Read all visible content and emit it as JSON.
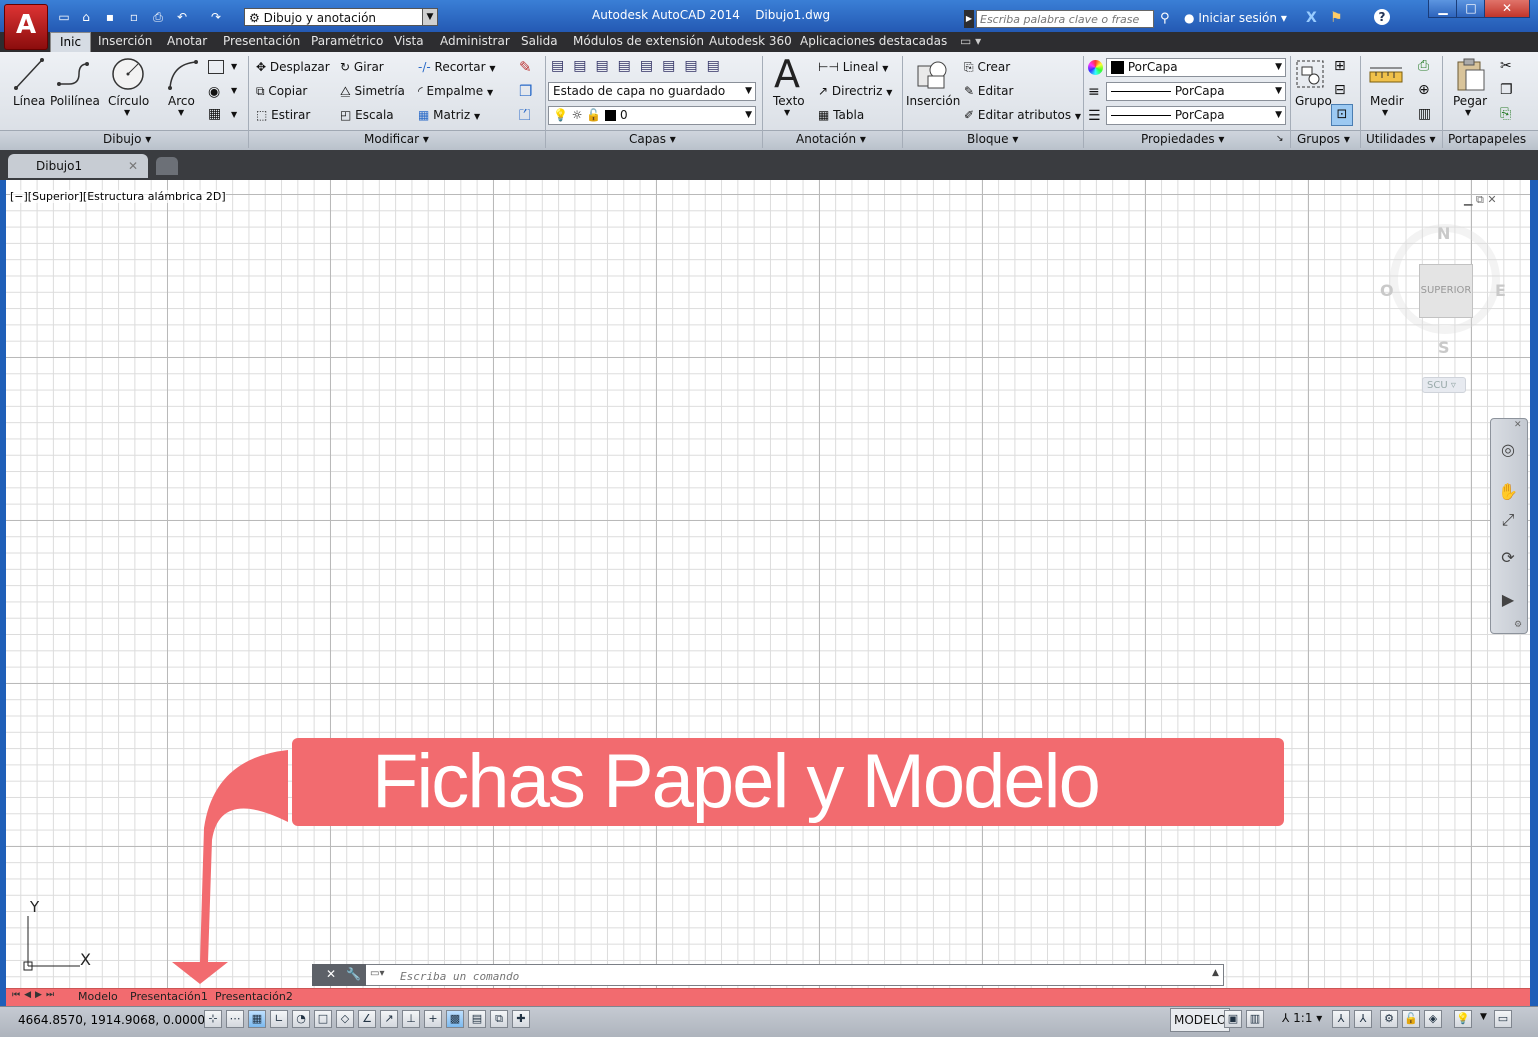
{
  "titlebar": {
    "workspace": "Dibujo y anotación",
    "app_name": "Autodesk AutoCAD 2014",
    "file_name": "Dibujo1.dwg",
    "search_placeholder": "Escriba palabra clave o frase",
    "sign_in": "Iniciar sesión"
  },
  "ribbon_tabs": [
    "Inic",
    "Inserción",
    "Anotar",
    "Presentación",
    "Paramétrico",
    "Vista",
    "Administrar",
    "Salida",
    "Módulos de extensión",
    "Autodesk 360",
    "Aplicaciones destacadas"
  ],
  "panels": {
    "draw": {
      "title": "Dibujo",
      "line": "Línea",
      "polyline": "Polilínea",
      "circle": "Círculo",
      "arc": "Arco"
    },
    "modify": {
      "title": "Modificar",
      "move": "Desplazar",
      "rotate": "Girar",
      "trim": "Recortar",
      "copy": "Copiar",
      "mirror": "Simetría",
      "fillet": "Empalme",
      "stretch": "Estirar",
      "scale": "Escala",
      "array": "Matriz"
    },
    "layers": {
      "title": "Capas",
      "state": "Estado de capa no guardado",
      "current": "0"
    },
    "annotation": {
      "title": "Anotación",
      "text": "Texto",
      "linear": "Lineal",
      "leader": "Directriz",
      "table": "Tabla"
    },
    "block": {
      "title": "Bloque",
      "insert": "Inserción",
      "create": "Crear",
      "edit": "Editar",
      "edit_attr": "Editar atributos"
    },
    "properties": {
      "title": "Propiedades",
      "color": "PorCapa",
      "linetype": "PorCapa",
      "lineweight": "PorCapa"
    },
    "groups": {
      "title": "Grupos",
      "group": "Grupo"
    },
    "utilities": {
      "title": "Utilidades",
      "measure": "Medir"
    },
    "clipboard": {
      "title": "Portapapeles",
      "paste": "Pegar"
    }
  },
  "document_tab": "Dibujo1",
  "viewport": {
    "label": "[−][Superior][Estructura alámbrica 2D]",
    "compass": {
      "n": "N",
      "s": "S",
      "e": "E",
      "w": "O"
    },
    "cube_face": "SUPERIOR",
    "ucs": "SCU",
    "ucs_y": "Y",
    "ucs_x": "X"
  },
  "annotation": {
    "callout": "Fichas Papel y Modelo",
    "color": "#f26b6f"
  },
  "command_line": {
    "placeholder": "Escriba un comando"
  },
  "layout_tabs": [
    "Modelo",
    "Presentación1",
    "Presentación2"
  ],
  "status": {
    "coords": "4664.8570, 1914.9068, 0.0000",
    "space": "MODELO",
    "scale": "1:1"
  }
}
